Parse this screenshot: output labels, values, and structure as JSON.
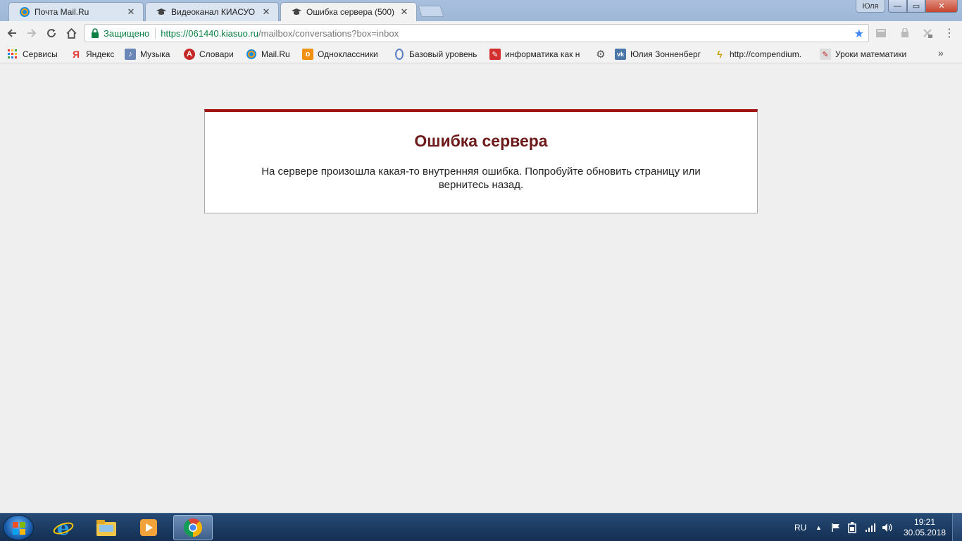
{
  "browser": {
    "tabs": [
      {
        "title": "Почта Mail.Ru",
        "icon": "mailru-icon",
        "active": false
      },
      {
        "title": "Видеоканал КИАСУО - Н",
        "icon": "graduation-cap-icon",
        "active": false
      },
      {
        "title": "Ошибка сервера (500)",
        "icon": "graduation-cap-icon",
        "active": true
      }
    ],
    "user_name": "Юля",
    "window_buttons": {
      "minimize": "—",
      "maximize": "▭",
      "close": "✕"
    },
    "security_label": "Защищено",
    "url_host": "https://061440.kiasuo.ru",
    "url_path": "/mailbox/conversations?box=inbox",
    "bookmarks": [
      {
        "label": "Сервисы",
        "icon": "apps-grid-icon"
      },
      {
        "label": "Яндекс",
        "icon": "yandex-icon"
      },
      {
        "label": "Музыка",
        "icon": "music-icon"
      },
      {
        "label": "Словари",
        "icon": "dictionary-icon"
      },
      {
        "label": "Mail.Ru",
        "icon": "mailru-icon"
      },
      {
        "label": "Одноклассники",
        "icon": "odnoklassniki-icon"
      },
      {
        "label": "Базовый уровень",
        "icon": "level-icon"
      },
      {
        "label": "информатика как н",
        "icon": "informatics-icon"
      },
      {
        "label": "",
        "icon": "gear-icon"
      },
      {
        "label": "Юлия Зонненберг",
        "icon": "vk-icon"
      },
      {
        "label": "http://compendium.",
        "icon": "compendium-icon"
      },
      {
        "label": "Уроки математики",
        "icon": "math-lessons-icon"
      }
    ],
    "more_bookmarks": "»"
  },
  "page": {
    "error_title": "Ошибка сервера",
    "error_message": "На сервере произошла какая-то внутренняя ошибка. Попробуйте обновить страницу или вернитесь назад."
  },
  "taskbar": {
    "apps": [
      {
        "name": "internet-explorer-icon",
        "active": false
      },
      {
        "name": "file-explorer-icon",
        "active": false
      },
      {
        "name": "media-player-icon",
        "active": false
      },
      {
        "name": "chrome-icon",
        "active": true
      }
    ],
    "language": "RU",
    "time": "19:21",
    "date": "30.05.2018"
  },
  "colors": {
    "error_accent": "#a01414",
    "error_title": "#6e1a1a",
    "secure_green": "#0b8043",
    "star_blue": "#4285f4"
  }
}
